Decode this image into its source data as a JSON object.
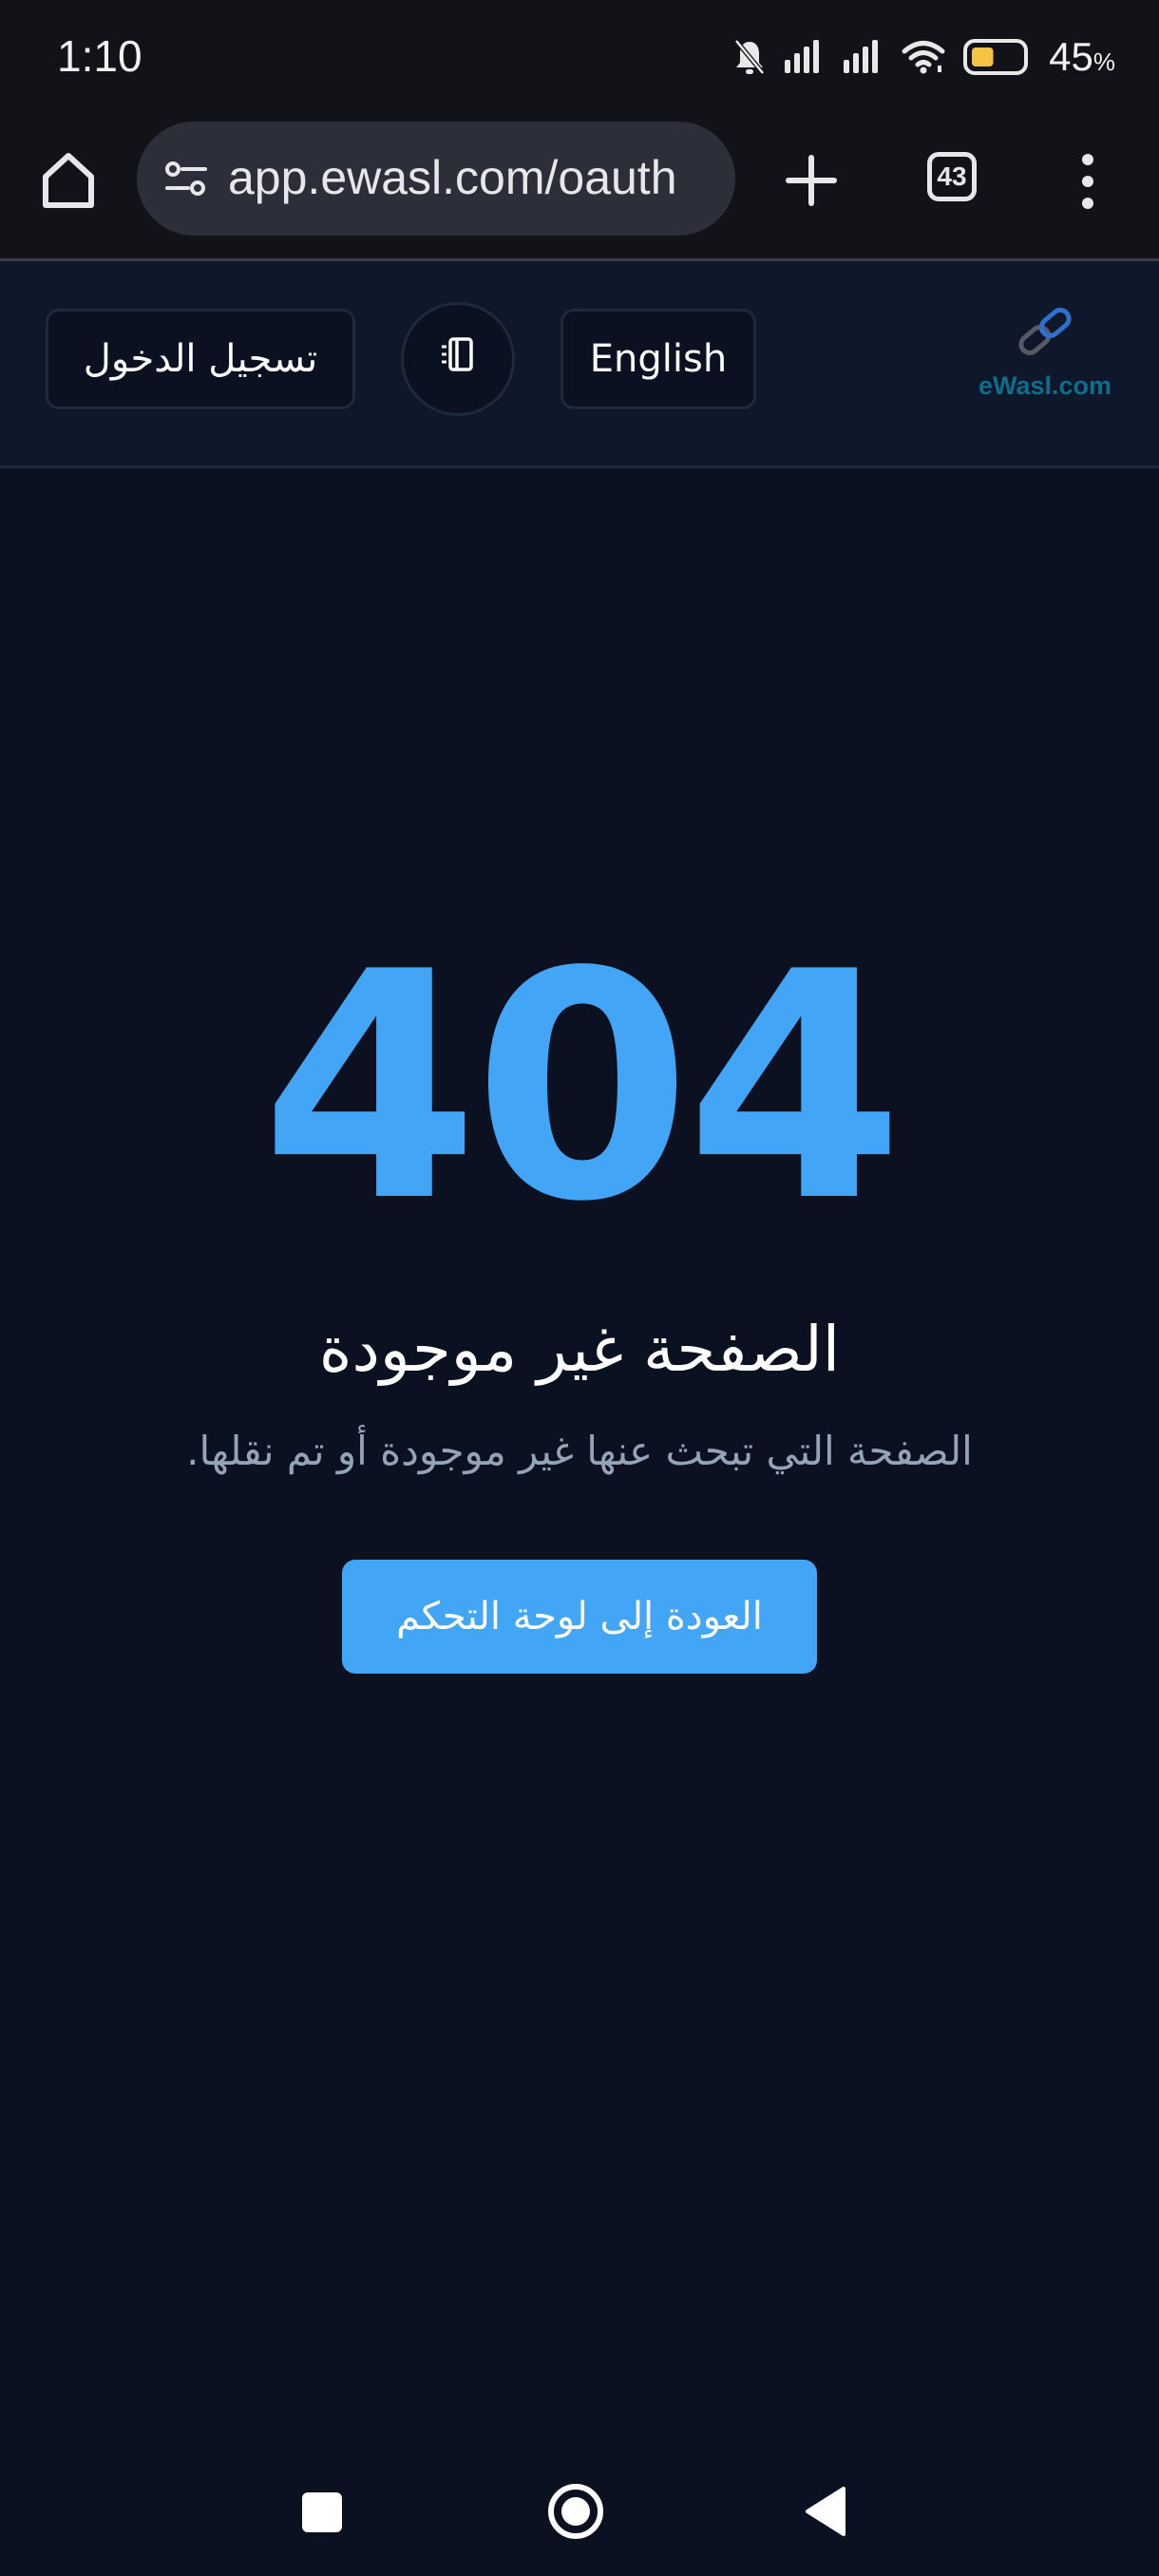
{
  "status_bar": {
    "time": "1:10",
    "battery_percent": "45",
    "battery_unit": "%",
    "battery_level": 0.45,
    "battery_color": "#f6c343"
  },
  "browser": {
    "url": "app.ewasl.com/oauth",
    "tab_count": "43",
    "icons": [
      "home-icon",
      "site-settings-icon",
      "plus-icon",
      "tabs-icon",
      "more-vert-icon"
    ]
  },
  "header": {
    "login_label": "تسجيل الدخول",
    "language_label": "English",
    "theme_icon": "theme-toggle-icon",
    "logo_text": "eWasl.com"
  },
  "main": {
    "error_code": "404",
    "title": "الصفحة غير موجودة",
    "subtitle": "الصفحة التي تبحث عنها غير موجودة أو تم نقلها.",
    "back_button": "العودة إلى لوحة التحكم",
    "accent_color": "#42a5f5"
  },
  "nav_bar": {
    "icons": [
      "recents-icon",
      "home-circle-icon",
      "back-triangle-icon"
    ]
  }
}
